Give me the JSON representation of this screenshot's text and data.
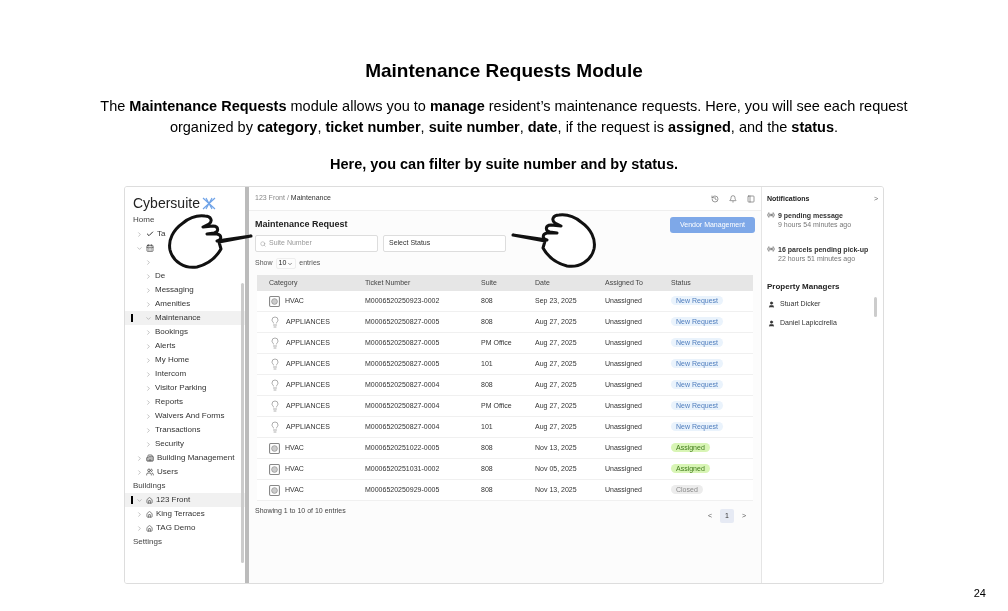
{
  "slide": {
    "title": "Maintenance Requests Module",
    "intro": "The **Maintenance Requests** module allows you to **manage** resident’s maintenance requests. Here, you will see each request organized by **category**, **ticket number**, **suite number**, **date**, if the request is **assigned**, and the **status**.",
    "note": "Here, you can filter by suite number and by status.",
    "page_number": "24"
  },
  "app": {
    "logo": "Cybersuite",
    "sidebar": {
      "sections": [
        {
          "title": "Home",
          "items": [
            {
              "label": "Ta",
              "kind": "check",
              "expanded": false,
              "selected": false
            },
            {
              "kind": "calendar",
              "expanded": true,
              "selected": false,
              "children": [
                {
                  "expanded": false,
                  "selected": false
                },
                {
                  "label": "De",
                  "expanded": false,
                  "selected": false
                },
                {
                  "label": "Messaging",
                  "expanded": false,
                  "selected": false
                },
                {
                  "label": "Amenities",
                  "expanded": false,
                  "selected": false
                },
                {
                  "label": "Maintenance",
                  "expanded": true,
                  "selected": true
                },
                {
                  "label": "Bookings",
                  "expanded": false,
                  "selected": false
                },
                {
                  "label": "Alerts",
                  "expanded": false,
                  "selected": false
                },
                {
                  "label": "My Home",
                  "expanded": false,
                  "selected": false
                },
                {
                  "label": "Intercom",
                  "expanded": false,
                  "selected": false
                },
                {
                  "label": "Visitor Parking",
                  "expanded": false,
                  "selected": false
                },
                {
                  "label": "Reports",
                  "expanded": false,
                  "selected": false
                },
                {
                  "label": "Waivers And Forms",
                  "expanded": false,
                  "selected": false
                },
                {
                  "label": "Transactions",
                  "expanded": false,
                  "selected": false
                },
                {
                  "label": "Security",
                  "expanded": false,
                  "selected": false
                }
              ]
            },
            {
              "label": "Building Management",
              "kind": "building",
              "expanded": false,
              "selected": false
            },
            {
              "label": "Users",
              "kind": "users",
              "expanded": false,
              "selected": false
            }
          ]
        },
        {
          "title": "Buildings",
          "items": [
            {
              "label": "123 Front",
              "kind": "site",
              "expanded": true,
              "selected": true
            },
            {
              "label": "King Terraces",
              "kind": "site",
              "expanded": false,
              "selected": false
            },
            {
              "label": "TAG Demo",
              "kind": "site",
              "expanded": false,
              "selected": false
            }
          ]
        },
        {
          "title": "Settings"
        }
      ]
    },
    "breadcrumb": [
      "123 Front",
      "/",
      "Maintenance"
    ],
    "page_title": "Maintenance Request",
    "vendor_button": "Vendor Management",
    "search": {
      "placeholder": "Suite Number"
    },
    "status_select": {
      "value": "Select Status"
    },
    "page_size": {
      "before": "Show",
      "value": "10",
      "after": "entries"
    },
    "table": {
      "columns": [
        "Category",
        "Ticket Number",
        "Suite",
        "Date",
        "Assigned To",
        "Status"
      ],
      "rows": [
        {
          "kind": "hvac",
          "category": "HVAC",
          "ticket": "M0006520250923-0002",
          "suite": "808",
          "date": "Sep 23, 2025",
          "assigned": "Unassigned",
          "status": {
            "label": "New Request",
            "kind": "new"
          }
        },
        {
          "kind": "appliance",
          "category": "APPLIANCES",
          "ticket": "M0006520250827-0005",
          "suite": "808",
          "date": "Aug 27, 2025",
          "assigned": "Unassigned",
          "status": {
            "label": "New Request",
            "kind": "new"
          }
        },
        {
          "kind": "appliance",
          "category": "APPLIANCES",
          "ticket": "M0006520250827-0005",
          "suite": "PM Office",
          "date": "Aug 27, 2025",
          "assigned": "Unassigned",
          "status": {
            "label": "New Request",
            "kind": "new"
          }
        },
        {
          "kind": "appliance",
          "category": "APPLIANCES",
          "ticket": "M0006520250827-0005",
          "suite": "101",
          "date": "Aug 27, 2025",
          "assigned": "Unassigned",
          "status": {
            "label": "New Request",
            "kind": "new"
          }
        },
        {
          "kind": "appliance",
          "category": "APPLIANCES",
          "ticket": "M0006520250827-0004",
          "suite": "808",
          "date": "Aug 27, 2025",
          "assigned": "Unassigned",
          "status": {
            "label": "New Request",
            "kind": "new"
          }
        },
        {
          "kind": "appliance",
          "category": "APPLIANCES",
          "ticket": "M0006520250827-0004",
          "suite": "PM Office",
          "date": "Aug 27, 2025",
          "assigned": "Unassigned",
          "status": {
            "label": "New Request",
            "kind": "new"
          }
        },
        {
          "kind": "appliance",
          "category": "APPLIANCES",
          "ticket": "M0006520250827-0004",
          "suite": "101",
          "date": "Aug 27, 2025",
          "assigned": "Unassigned",
          "status": {
            "label": "New Request",
            "kind": "new"
          }
        },
        {
          "kind": "hvac",
          "category": "HVAC",
          "ticket": "M0006520251022-0005",
          "suite": "808",
          "date": "Nov 13, 2025",
          "assigned": "Unassigned",
          "status": {
            "label": "Assigned",
            "kind": "assigned"
          }
        },
        {
          "kind": "hvac",
          "category": "HVAC",
          "ticket": "M0006520251031-0002",
          "suite": "808",
          "date": "Nov 05, 2025",
          "assigned": "Unassigned",
          "status": {
            "label": "Assigned",
            "kind": "assigned"
          }
        },
        {
          "kind": "hvac",
          "category": "HVAC",
          "ticket": "M0006520250929-0005",
          "suite": "808",
          "date": "Nov 13, 2025",
          "assigned": "Unassigned",
          "status": {
            "label": "Closed",
            "kind": "closed"
          }
        }
      ]
    },
    "footer": "Showing 1 to 10 of 10 entries",
    "pagination": [
      {
        "label": "<",
        "selected": false
      },
      {
        "label": "1",
        "selected": true
      },
      {
        "label": ">",
        "selected": false
      }
    ],
    "notifications": {
      "title": "Notifications",
      "toggle": ">",
      "items": [
        {
          "text": "9 pending message",
          "time": "9 hours 54 minutes ago"
        },
        {
          "text": "16 parcels pending pick-up",
          "time": "22 hours 51 minutes ago"
        }
      ]
    },
    "managers": {
      "title": "Property Managers",
      "items": [
        "Stuart Dicker",
        "Daniel Lapiccirella"
      ]
    }
  }
}
